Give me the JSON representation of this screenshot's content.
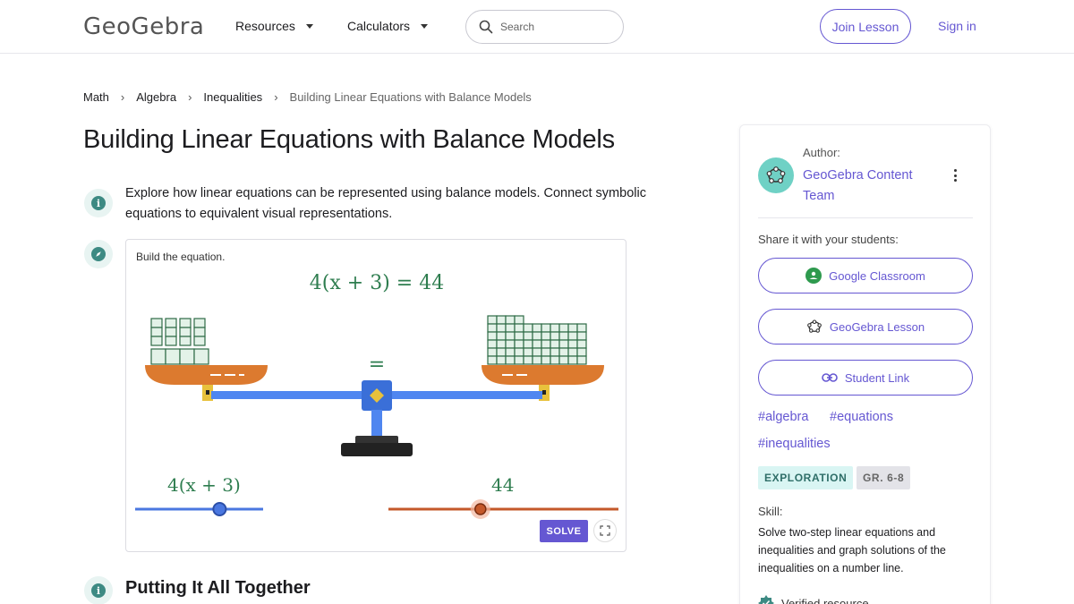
{
  "header": {
    "logo": "GeoGebra",
    "nav": [
      {
        "label": "Resources"
      },
      {
        "label": "Calculators"
      }
    ],
    "search_placeholder": "Search",
    "join_label": "Join Lesson",
    "signin_label": "Sign in"
  },
  "breadcrumb": [
    "Math",
    "Algebra",
    "Inequalities",
    "Building Linear Equations with Balance Models"
  ],
  "page_title": "Building Linear Equations with Balance Models",
  "description": "Explore how linear equations can be represented using balance models. Connect symbolic equations to equivalent visual representations.",
  "applet": {
    "prompt": "Build the equation.",
    "equation": "4(x + 3) = 44",
    "equals_sign": "=",
    "left_expression": "4(x + 3)",
    "right_value": "44",
    "left_slider_value": 0.66,
    "right_slider_value": 0.4,
    "solve_label": "SOLVE"
  },
  "section_title": "Putting It All Together",
  "panel": {
    "author_label": "Author:",
    "author_name": "GeoGebra Content Team",
    "share_label": "Share it with your students:",
    "share_buttons": [
      {
        "label": "Google Classroom",
        "icon": "google-classroom-icon"
      },
      {
        "label": "GeoGebra Lesson",
        "icon": "geogebra-icon"
      },
      {
        "label": "Student Link",
        "icon": "link-icon"
      }
    ],
    "tags": [
      "#algebra",
      "#equations",
      "#inequalities"
    ],
    "badges": [
      "EXPLORATION",
      "GR. 6-8"
    ],
    "skill_label": "Skill:",
    "skill_text": "Solve two-step linear equations and inequalities and graph solutions of the inequalities on a number line.",
    "verified_label": "Verified resource"
  },
  "colors": {
    "accent": "#6557d2",
    "teal": "#3d8a83",
    "equation_green": "#2e7d4f",
    "tray_orange": "#dc7a2f",
    "beam_blue": "#4f86f0"
  }
}
